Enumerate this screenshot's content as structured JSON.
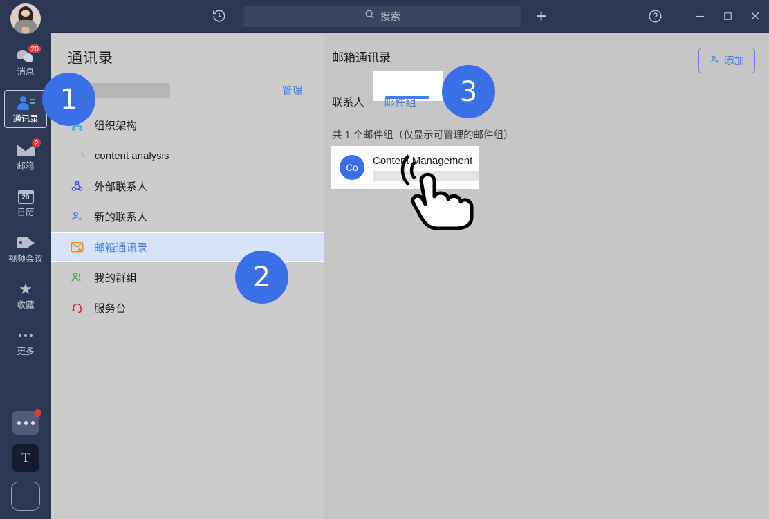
{
  "window": {
    "title_bar": {
      "history_icon": "history-clock-icon",
      "search_placeholder": "搜索",
      "add_icon": "plus-icon",
      "help_icon": "question-circle-icon",
      "minimize_icon": "minimize-icon",
      "maximize_icon": "maximize-icon",
      "close_icon": "close-icon"
    }
  },
  "rail": {
    "avatar": "user-avatar",
    "items": [
      {
        "label": "消息",
        "icon": "chat-bubbles-icon",
        "badge": "20",
        "active": false
      },
      {
        "label": "通讯录",
        "icon": "contacts-icon",
        "badge": "",
        "active": true
      },
      {
        "label": "邮箱",
        "icon": "envelope-icon",
        "badge": "2",
        "active": false
      },
      {
        "label": "日历",
        "icon": "calendar-icon",
        "badge": "",
        "day": "29",
        "active": false
      },
      {
        "label": "视频会议",
        "icon": "video-camera-icon",
        "badge": "",
        "active": false
      },
      {
        "label": "收藏",
        "icon": "star-icon",
        "badge": "",
        "active": false
      },
      {
        "label": "更多",
        "icon": "ellipsis-icon",
        "badge": "",
        "active": false
      }
    ],
    "bottom": {
      "more_apps_icon": "ellipsis-box-icon",
      "translate_label": "T",
      "blank_app_icon": "rounded-square-icon"
    }
  },
  "sidepanel": {
    "title": "通讯录",
    "org_name_redacted": "",
    "manage_label": "管理",
    "items": [
      {
        "label": "组织架构",
        "icon": "org-chart-icon",
        "selected": false
      },
      {
        "label": "外部联系人",
        "icon": "external-contacts-icon",
        "selected": false
      },
      {
        "label": "新的联系人",
        "icon": "add-contact-icon",
        "selected": false
      },
      {
        "label": "邮箱通讯录",
        "icon": "mail-contacts-icon",
        "selected": true
      },
      {
        "label": "我的群组",
        "icon": "my-groups-icon",
        "selected": false
      },
      {
        "label": "服务台",
        "icon": "headset-icon",
        "selected": false
      }
    ],
    "sub_item": {
      "label": "content analysis",
      "tree_glyph": "└"
    }
  },
  "main": {
    "title": "邮箱通讯录",
    "add_button": {
      "label": "添加",
      "icon": "add-person-icon"
    },
    "tabs": [
      {
        "label": "联系人",
        "active": false
      },
      {
        "label": "邮件组",
        "active": true
      }
    ],
    "count_text": "共 1 个邮件组（仅显示可管理的邮件组）",
    "groups": [
      {
        "initials": "Co",
        "name": "Content Management",
        "detail_redacted": ""
      }
    ]
  },
  "steps": [
    {
      "number": "1"
    },
    {
      "number": "2"
    },
    {
      "number": "3"
    }
  ],
  "colors": {
    "rail_bg": "#2b3855",
    "panel_bg": "#cccccc",
    "main_bg": "#c6c6c6",
    "accent_blue": "#3b6fe8",
    "link_blue": "#4a7fe0",
    "badge_red": "#e0393e",
    "selected_row": "#d9e3f8"
  }
}
